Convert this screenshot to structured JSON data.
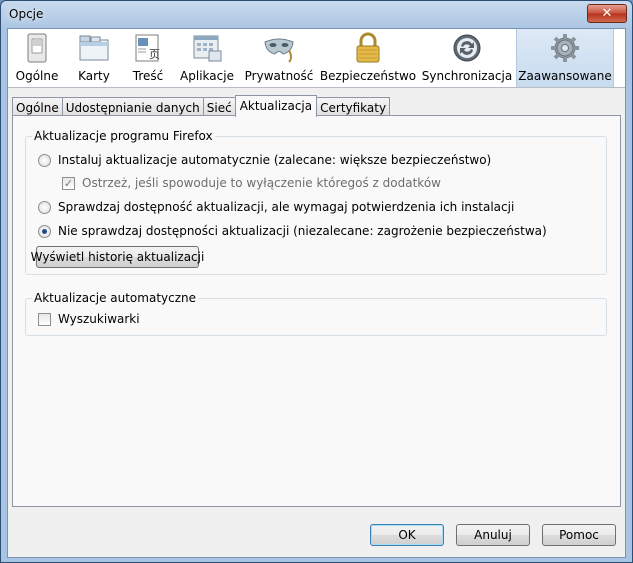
{
  "window": {
    "title": "Opcje",
    "close_glyph": "✕"
  },
  "toolbar": {
    "panes": [
      {
        "label": "Ogólne",
        "icon": "switch-icon"
      },
      {
        "label": "Karty",
        "icon": "tabs-icon"
      },
      {
        "label": "Treść",
        "icon": "content-icon"
      },
      {
        "label": "Aplikacje",
        "icon": "applications-icon"
      },
      {
        "label": "Prywatność",
        "icon": "mask-icon"
      },
      {
        "label": "Bezpieczeństwo",
        "icon": "padlock-icon"
      },
      {
        "label": "Synchronizacja",
        "icon": "sync-icon"
      },
      {
        "label": "Zaawansowane",
        "icon": "gear-icon"
      }
    ],
    "selected": "Zaawansowane"
  },
  "tabs": [
    {
      "label": "Ogólne"
    },
    {
      "label": "Udostępnianie danych"
    },
    {
      "label": "Sieć"
    },
    {
      "label": "Aktualizacja"
    },
    {
      "label": "Certyfikaty"
    }
  ],
  "active_tab": "Aktualizacja",
  "firefox_updates": {
    "legend": "Aktualizacje programu Firefox",
    "auto_install": "Instaluj aktualizacje automatycznie (zalecane: większe bezpieczeństwo)",
    "warn_addons": "Ostrzeż, jeśli spowoduje to wyłączenie któregoś z dodatków",
    "ask_before": "Sprawdzaj dostępność aktualizacji, ale wymagaj potwierdzenia ich instalacji",
    "never_check": "Nie sprawdzaj dostępności aktualizacji (niezalecane: zagrożenie bezpieczeństwa)",
    "history_button": "Wyświetl historię aktualizacji",
    "selected_option": "never_check",
    "warn_addons_checked": true
  },
  "auto_updates": {
    "legend": "Aktualizacje automatyczne",
    "search_engines": "Wyszukiwarki",
    "search_engines_checked": false
  },
  "buttons": {
    "ok": "OK",
    "cancel": "Anuluj",
    "help": "Pomoc"
  }
}
